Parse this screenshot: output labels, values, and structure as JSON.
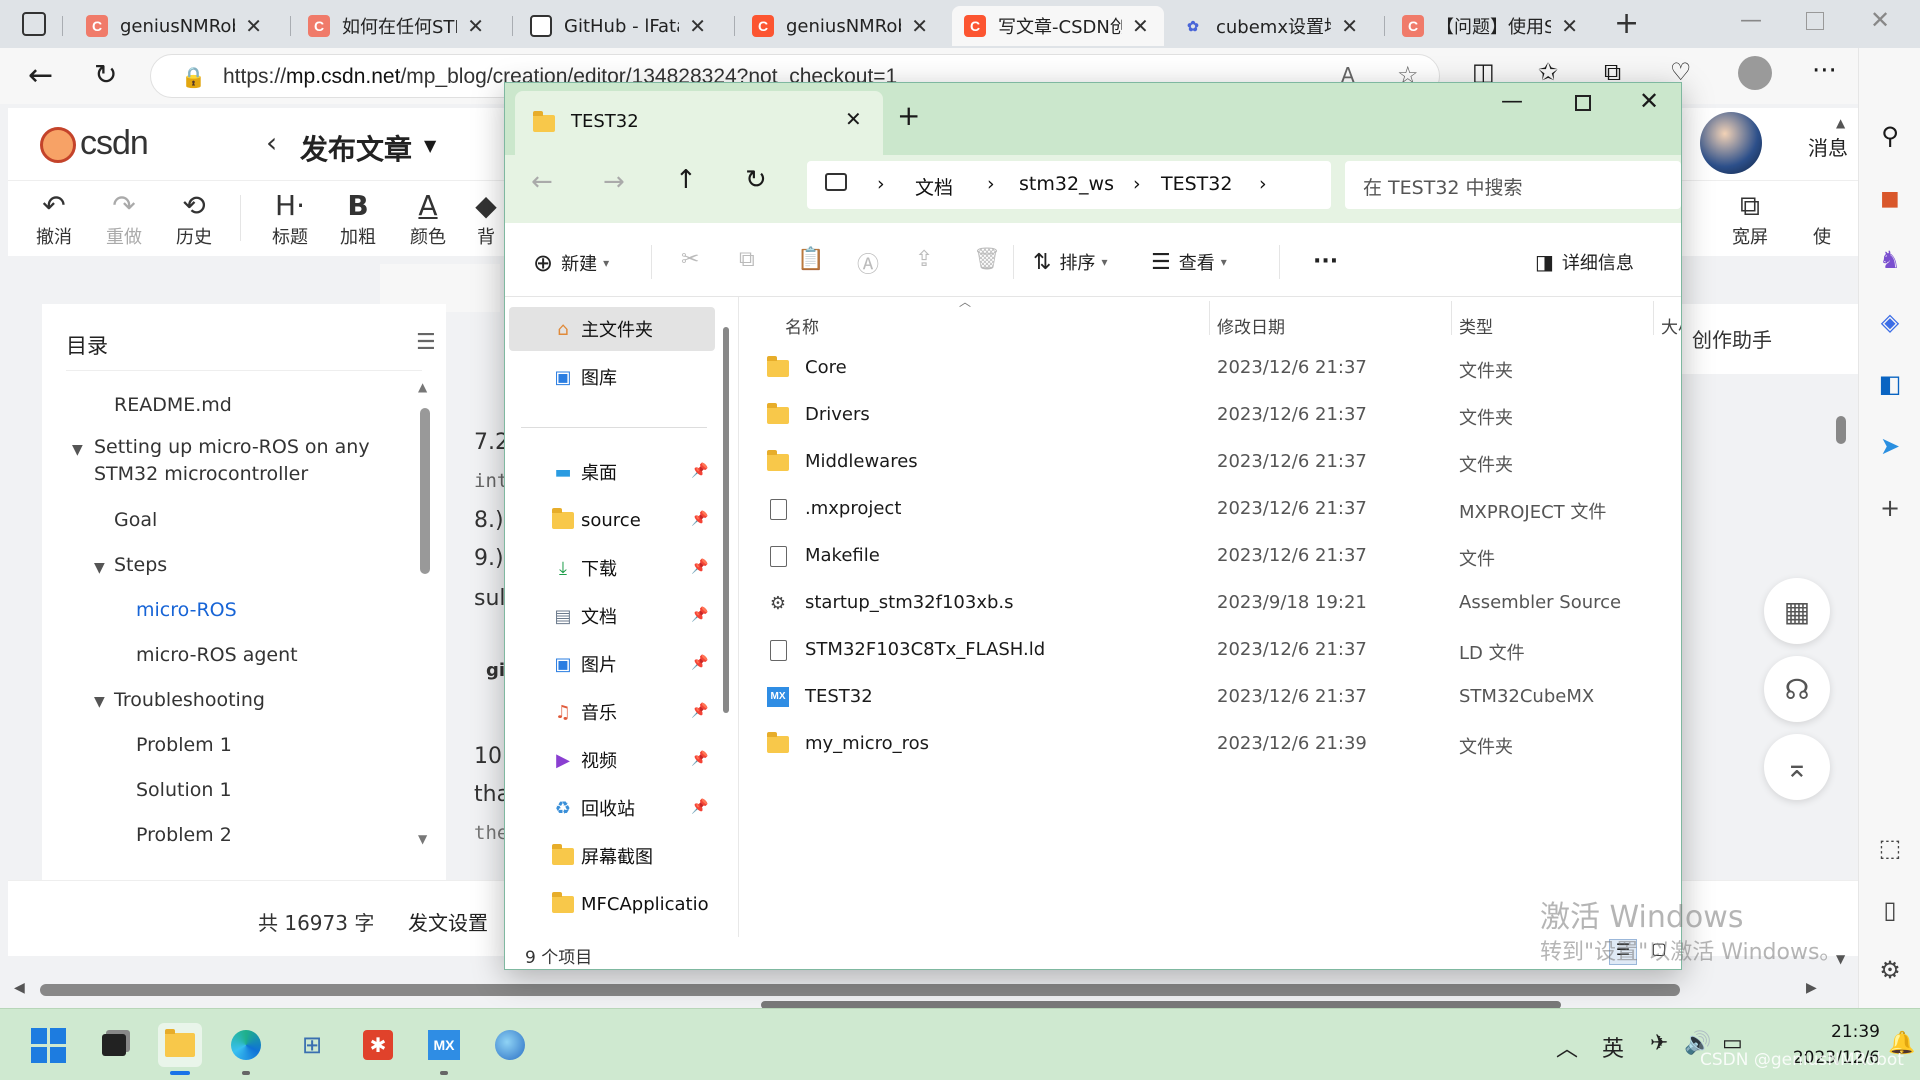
{
  "browser": {
    "tabs": [
      {
        "title": "geniusNMRobc",
        "favicon": "csdn-icon"
      },
      {
        "title": "如何在任何STM",
        "favicon": "csdn-icon"
      },
      {
        "title": "GitHub - lFatali",
        "favicon": "github-icon"
      },
      {
        "title": "geniusNMRobc",
        "favicon": "csdn-icon"
      },
      {
        "title": "写文章-CSDN创",
        "favicon": "csdn-icon",
        "active": true
      },
      {
        "title": "cubemx设置堆",
        "favicon": "baidu-icon"
      },
      {
        "title": "【问题】使用S",
        "favicon": "csdn-icon"
      }
    ],
    "url_prefix": "https://",
    "url_host": "mp.csdn.net",
    "url_path": "/mp_blog/creation/editor/134828324?not_checkout=1"
  },
  "csdn": {
    "logo": "CSDN",
    "publish_title": "发布文章",
    "toolbar": [
      "撤消",
      "重做",
      "历史",
      "标题",
      "加粗",
      "颜色",
      "背",
      "宽屏",
      "使"
    ],
    "toolbar_partial": [
      "宽屏"
    ],
    "toc_title": "目录",
    "toc": [
      {
        "label": "README.md",
        "level": 1
      },
      {
        "label": "Setting up micro-ROS on any",
        "level": 0
      },
      {
        "label": "STM32 microcontroller",
        "level": 0
      },
      {
        "label": "Goal",
        "level": 1
      },
      {
        "label": "Steps",
        "level": 1
      },
      {
        "label": "micro-ROS",
        "level": 2,
        "active": true
      },
      {
        "label": "micro-ROS agent",
        "level": 2
      },
      {
        "label": "Troubleshooting",
        "level": 1
      },
      {
        "label": "Problem 1",
        "level": 2
      },
      {
        "label": "Solution 1",
        "level": 2
      },
      {
        "label": "Problem 2",
        "level": 2
      }
    ],
    "editor_fragments": [
      "7.2",
      "int",
      "8.)",
      "9.)",
      "sul",
      "gi",
      "10",
      "tha",
      "the",
      "##",
      "#",
      "##"
    ],
    "word_count": "共 16973 字",
    "publish_settings": "发文设置",
    "assistant": "创作助手",
    "messages": "消息"
  },
  "explorer": {
    "tab_title": "TEST32",
    "breadcrumb": [
      "文档",
      "stm32_ws",
      "TEST32"
    ],
    "search_placeholder": "在 TEST32 中搜索",
    "commands": {
      "new": "新建",
      "sort": "排序",
      "view": "查看",
      "more": "···",
      "details": "详细信息"
    },
    "nav": [
      {
        "label": "主文件夹",
        "icon": "home-icon"
      },
      {
        "label": "图库",
        "icon": "gallery-icon"
      },
      {
        "label": "桌面",
        "icon": "desktop-icon",
        "pinned": true
      },
      {
        "label": "source",
        "icon": "folder-icon",
        "pinned": true
      },
      {
        "label": "下载",
        "icon": "download-icon",
        "pinned": true
      },
      {
        "label": "文档",
        "icon": "document-icon",
        "pinned": true
      },
      {
        "label": "图片",
        "icon": "pictures-icon",
        "pinned": true
      },
      {
        "label": "音乐",
        "icon": "music-icon",
        "pinned": true
      },
      {
        "label": "视频",
        "icon": "video-icon",
        "pinned": true
      },
      {
        "label": "回收站",
        "icon": "recycle-bin-icon",
        "pinned": true
      },
      {
        "label": "屏幕截图",
        "icon": "folder-icon"
      },
      {
        "label": "MFCApplicatio",
        "icon": "folder-icon"
      }
    ],
    "columns": [
      "名称",
      "修改日期",
      "类型",
      "大小"
    ],
    "columns_display": [
      "名称",
      "修改日期",
      "类型",
      "大小"
    ],
    "files": [
      {
        "name": "Core",
        "date": "2023/12/6 21:37",
        "type": "文件夹",
        "icon": "folder-icon"
      },
      {
        "name": "Drivers",
        "date": "2023/12/6 21:37",
        "type": "文件夹",
        "icon": "folder-icon"
      },
      {
        "name": "Middlewares",
        "date": "2023/12/6 21:37",
        "type": "文件夹",
        "icon": "folder-icon"
      },
      {
        "name": ".mxproject",
        "date": "2023/12/6 21:37",
        "type": "MXPROJECT 文件",
        "icon": "file-icon"
      },
      {
        "name": "Makefile",
        "date": "2023/12/6 21:37",
        "type": "文件",
        "icon": "file-icon"
      },
      {
        "name": "startup_stm32f103xb.s",
        "date": "2023/9/18 19:21",
        "type": "Assembler Source",
        "icon": "assembler-file-icon"
      },
      {
        "name": "STM32F103C8Tx_FLASH.ld",
        "date": "2023/12/6 21:37",
        "type": "LD 文件",
        "icon": "file-icon"
      },
      {
        "name": "TEST32",
        "date": "2023/12/6 21:37",
        "type": "STM32CubeMX",
        "icon": "stm32cubemx-icon"
      },
      {
        "name": "my_micro_ros",
        "date": "2023/12/6 21:39",
        "type": "文件夹",
        "icon": "folder-icon"
      }
    ],
    "item_count": "9 个项目"
  },
  "watermark": {
    "line1": "激活 Windows",
    "line2": "转到\"设置\"以激活 Windows。"
  },
  "taskbar": {
    "ime": "英",
    "time": "21:39",
    "date": "2023/12/6",
    "csdn_watermark": "CSDN @geniusNMRobot"
  },
  "colors": {
    "accent": "#1764d6",
    "taskbar": "#cfe9d0",
    "explorer_chrome": "#cbe7cc",
    "csdn_red": "#fc5531"
  }
}
